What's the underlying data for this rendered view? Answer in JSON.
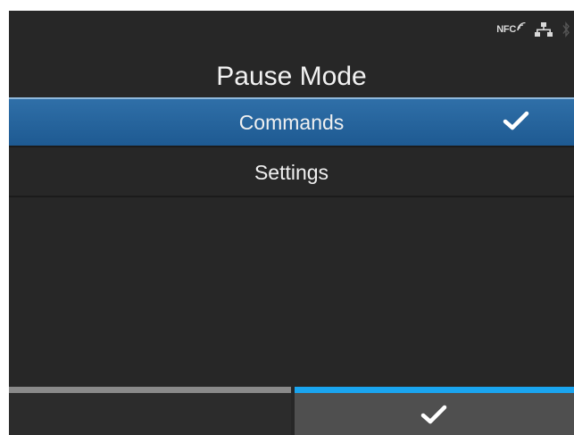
{
  "status": {
    "nfc_label": "NFC",
    "icons": [
      "nfc-icon",
      "wired-network-icon",
      "bluetooth-icon"
    ]
  },
  "header": {
    "title": "Pause Mode"
  },
  "menu": {
    "items": [
      {
        "label": "Commands",
        "selected": true,
        "checked": true
      },
      {
        "label": "Settings",
        "selected": false,
        "checked": false
      }
    ]
  },
  "softkeys": {
    "left": {
      "icon": null
    },
    "right": {
      "icon": "check-icon"
    }
  },
  "colors": {
    "background": "#272727",
    "selected_row": "#1e5a92",
    "active_softkey_bar": "#1aa5f0",
    "inactive_softkey_bar": "#8a8a8a",
    "text": "#f0f0f0"
  }
}
